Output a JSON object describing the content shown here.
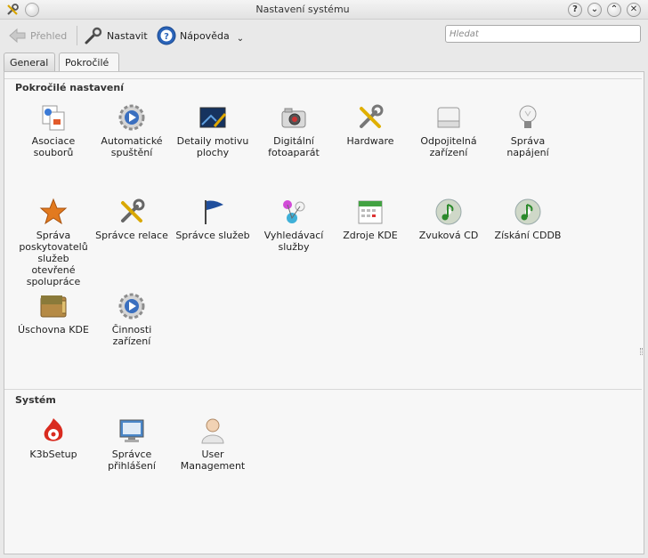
{
  "window": {
    "title": "Nastavení systému",
    "buttons": [
      "?",
      "⌄",
      "⌃",
      "✕"
    ]
  },
  "toolbar": {
    "back_label": "Přehled",
    "configure_label": "Nastavit",
    "help_label": "Nápověda",
    "help_menu_arrow": "⌄",
    "search_placeholder": "Hledat"
  },
  "tabs": [
    {
      "label": "General",
      "active": false
    },
    {
      "label": "Pokročilé",
      "active": true
    }
  ],
  "groups": {
    "advanced": {
      "title": "Pokročilé nastavení",
      "items": [
        {
          "label": "Asociace souborů",
          "icon": "file-associations-icon"
        },
        {
          "label": "Automatické spuštění",
          "icon": "autostart-gear-icon"
        },
        {
          "label": "Detaily motivu plochy",
          "icon": "desktop-theme-icon"
        },
        {
          "label": "Digitální fotoaparát",
          "icon": "camera-icon"
        },
        {
          "label": "Hardware",
          "icon": "hardware-tools-icon"
        },
        {
          "label": "Odpojitelná zařízení",
          "icon": "removable-drive-icon"
        },
        {
          "label": "Správa napájení",
          "icon": "power-bulb-icon"
        },
        {
          "label": "Správa poskytovatelů služeb otevřené spolupráce",
          "icon": "star-icon"
        },
        {
          "label": "Správce relace",
          "icon": "session-tools-icon"
        },
        {
          "label": "Správce služeb",
          "icon": "service-flag-icon"
        },
        {
          "label": "Vyhledávací služby",
          "icon": "search-services-icon"
        },
        {
          "label": "Zdroje KDE",
          "icon": "calendar-icon"
        },
        {
          "label": "Zvuková CD",
          "icon": "audio-cd-icon"
        },
        {
          "label": "Získání CDDB",
          "icon": "cddb-cd-icon"
        },
        {
          "label": "Úschovna KDE",
          "icon": "wallet-icon"
        },
        {
          "label": "Činnosti zařízení",
          "icon": "device-actions-gear-icon"
        }
      ]
    },
    "system": {
      "title": "Systém",
      "items": [
        {
          "label": "K3bSetup",
          "icon": "k3b-flame-icon"
        },
        {
          "label": "Správce přihlášení",
          "icon": "login-manager-icon"
        },
        {
          "label": "User Management",
          "icon": "user-icon"
        }
      ]
    }
  }
}
